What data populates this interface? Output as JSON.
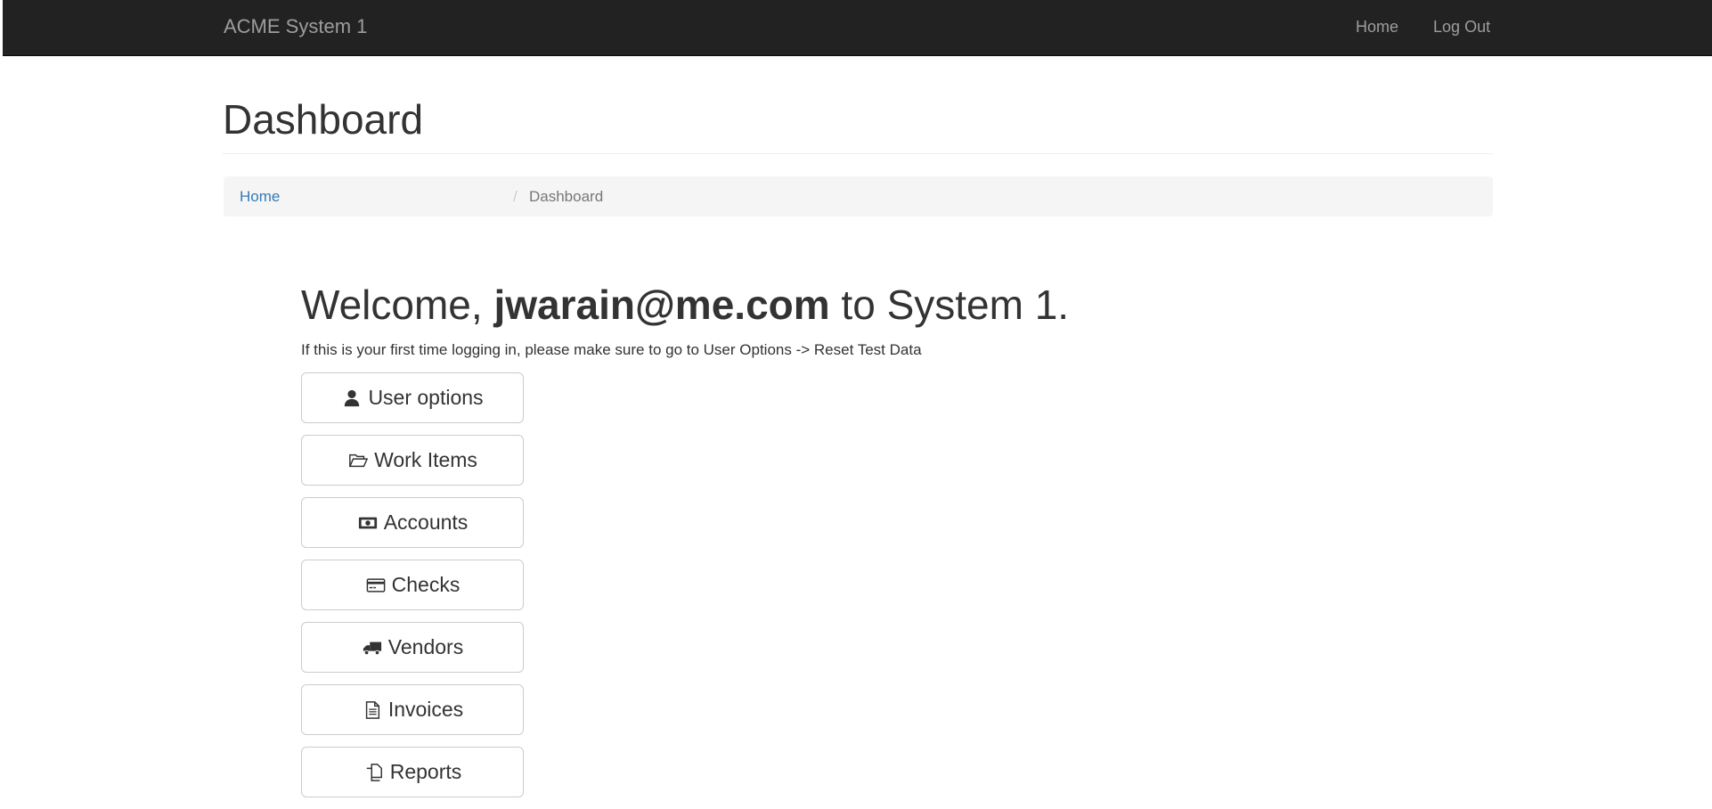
{
  "navbar": {
    "brand": "ACME System 1",
    "links": [
      "Home",
      "Log Out"
    ]
  },
  "page": {
    "title": "Dashboard"
  },
  "breadcrumb": {
    "home": "Home",
    "separator": "/",
    "current": "Dashboard"
  },
  "welcome": {
    "prefix": "Welcome, ",
    "user": "jwarain@me.com",
    "suffix": " to System 1.",
    "hint": "If this is your first time logging in, please make sure to go to User Options -> Reset Test Data"
  },
  "menu": [
    {
      "label": "User options",
      "icon": "user-icon"
    },
    {
      "label": "Work Items",
      "icon": "folder-open-icon"
    },
    {
      "label": "Accounts",
      "icon": "money-icon"
    },
    {
      "label": "Checks",
      "icon": "credit-card-icon"
    },
    {
      "label": "Vendors",
      "icon": "truck-icon"
    },
    {
      "label": "Invoices",
      "icon": "file-text-icon"
    },
    {
      "label": "Reports",
      "icon": "files-icon"
    }
  ],
  "colors": {
    "navbar_bg": "#222222",
    "navbar_text": "#9d9d9d",
    "link": "#337ab7",
    "breadcrumb_bg": "#f5f5f5"
  }
}
